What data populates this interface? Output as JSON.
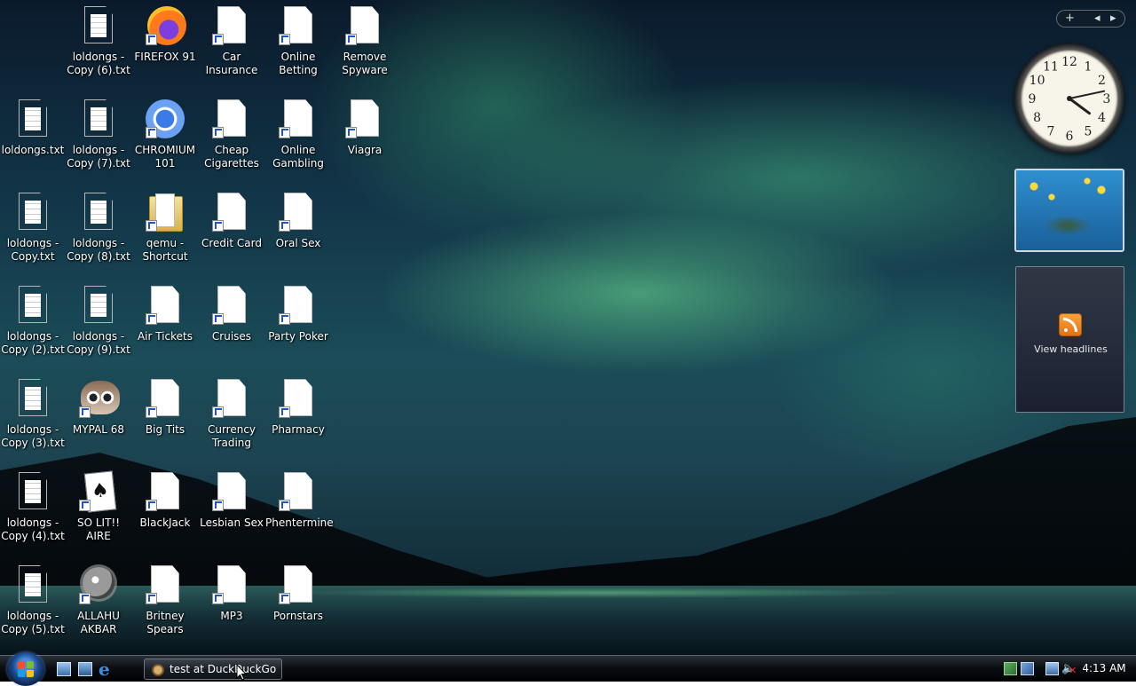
{
  "desktop": {
    "icons": [
      {
        "label": "loldongs - Copy (6).txt",
        "icon": "text-file-icon"
      },
      {
        "label": "FIREFOX 91",
        "icon": "firefox-icon"
      },
      {
        "label": "Car Insurance",
        "icon": "shortcut-file-icon"
      },
      {
        "label": "Online Betting",
        "icon": "shortcut-file-icon"
      },
      {
        "label": "Remove Spyware",
        "icon": "shortcut-file-icon"
      },
      {
        "label": "loldongs.txt",
        "icon": "text-file-icon"
      },
      {
        "label": "loldongs - Copy (7).txt",
        "icon": "text-file-icon"
      },
      {
        "label": "CHROMIUM 101",
        "icon": "chromium-icon"
      },
      {
        "label": "Cheap Cigarettes",
        "icon": "shortcut-file-icon"
      },
      {
        "label": "Online Gambling",
        "icon": "shortcut-file-icon"
      },
      {
        "label": "Viagra",
        "icon": "shortcut-file-icon"
      },
      {
        "label": "loldongs - Copy.txt",
        "icon": "text-file-icon"
      },
      {
        "label": "loldongs - Copy (8).txt",
        "icon": "text-file-icon"
      },
      {
        "label": "qemu - Shortcut",
        "icon": "folder-shortcut-icon"
      },
      {
        "label": "Credit Card",
        "icon": "shortcut-file-icon"
      },
      {
        "label": "Oral Sex",
        "icon": "shortcut-file-icon"
      },
      {
        "label": "loldongs - Copy (2).txt",
        "icon": "text-file-icon"
      },
      {
        "label": "loldongs - Copy (9).txt",
        "icon": "text-file-icon"
      },
      {
        "label": "Air Tickets",
        "icon": "shortcut-file-icon"
      },
      {
        "label": "Cruises",
        "icon": "shortcut-file-icon"
      },
      {
        "label": "Party Poker",
        "icon": "shortcut-file-icon"
      },
      {
        "label": "loldongs - Copy (3).txt",
        "icon": "text-file-icon"
      },
      {
        "label": "MYPAL 68",
        "icon": "mypal-raccoon-icon"
      },
      {
        "label": "Big Tits",
        "icon": "shortcut-file-icon"
      },
      {
        "label": "Currency Trading",
        "icon": "shortcut-file-icon"
      },
      {
        "label": "Pharmacy",
        "icon": "shortcut-file-icon"
      },
      {
        "label": "loldongs - Copy (4).txt",
        "icon": "text-file-icon"
      },
      {
        "label": "SO LIT!! AIRE",
        "icon": "solitaire-cards-icon"
      },
      {
        "label": "BlackJack",
        "icon": "shortcut-file-icon"
      },
      {
        "label": "Lesbian Sex",
        "icon": "shortcut-file-icon"
      },
      {
        "label": "Phentermine",
        "icon": "shortcut-file-icon"
      },
      {
        "label": "loldongs - Copy (5).txt",
        "icon": "text-file-icon"
      },
      {
        "label": "ALLAHU AKBAR",
        "icon": "minesweeper-mine-icon"
      },
      {
        "label": "Britney Spears",
        "icon": "shortcut-file-icon"
      },
      {
        "label": "MP3",
        "icon": "shortcut-file-icon"
      },
      {
        "label": "Pornstars",
        "icon": "shortcut-file-icon"
      }
    ]
  },
  "sidebar": {
    "add_label": "+",
    "prev_label": "◂",
    "next_label": "▸",
    "clock": {
      "hour": 4,
      "minute": 13,
      "numbers": [
        "12",
        "1",
        "2",
        "3",
        "4",
        "5",
        "6",
        "7",
        "8",
        "9",
        "10",
        "11"
      ]
    },
    "slideshow": {
      "icon": "sea-turtle-photo"
    },
    "feed": {
      "label": "View headlines",
      "icon": "rss-icon"
    }
  },
  "taskbar": {
    "start_icon": "windows-start-orb-icon",
    "quick_launch": [
      "show-desktop-icon",
      "switch-windows-icon",
      "internet-explorer-icon"
    ],
    "ie_glyph": "e",
    "task_button_label": "test at DuckDuckGo ...",
    "tray_clock": "4:13 AM",
    "volume_glyph": "🔈",
    "mute_glyph": "✕"
  },
  "colors": {
    "accent": "#1e9be8",
    "taskbar": "#0b0e12",
    "mute": "#e02d2d"
  }
}
